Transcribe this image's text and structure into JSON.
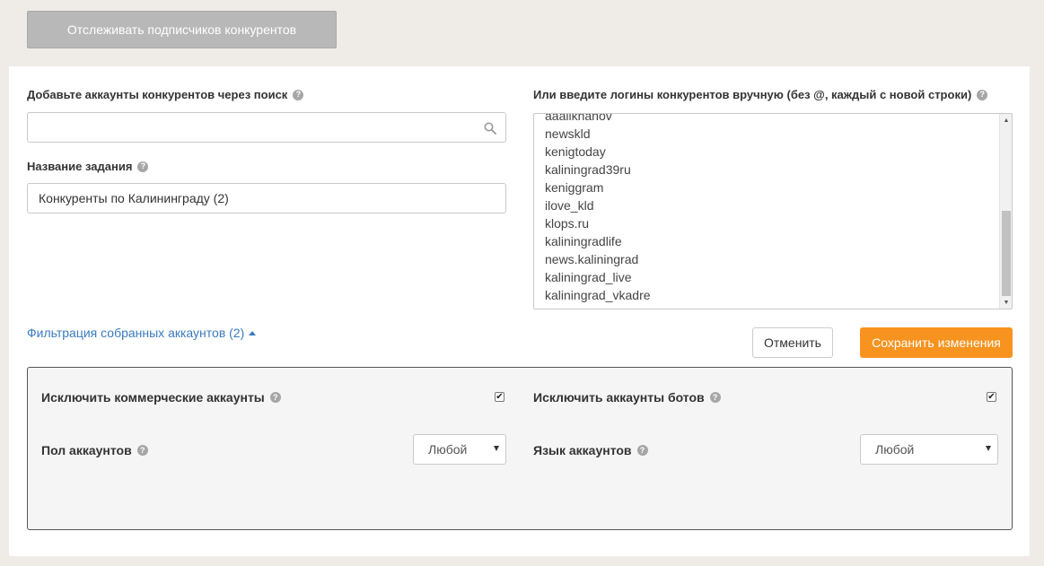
{
  "top_button": {
    "label": "Отслеживать подписчиков конкурентов"
  },
  "search_section": {
    "label": "Добавьте аккаунты конкурентов через поиск",
    "value": "",
    "placeholder": ""
  },
  "task_name": {
    "label": "Название задания",
    "value": "Конкуренты по Калининграду (2)"
  },
  "manual_logins": {
    "label": "Или введите логины конкурентов вручную (без @, каждый с новой строки)",
    "lines": [
      "aaalikhanov",
      "newskld",
      "kenigtoday",
      "kaliningrad39ru",
      "keniggram",
      "ilove_kld",
      "klops.ru",
      "kaliningradlife",
      "news.kaliningrad",
      "kaliningrad_live",
      "kaliningrad_vkadre"
    ]
  },
  "filter_link": {
    "label": "Фильтрация собранных аккаунтов (2)"
  },
  "buttons": {
    "cancel": "Отменить",
    "save": "Сохранить изменения"
  },
  "filters": {
    "exclude_commercial": {
      "label": "Исключить коммерческие аккаунты",
      "checked": true
    },
    "exclude_bots": {
      "label": "Исключить аккаунты ботов",
      "checked": true
    },
    "gender": {
      "label": "Пол аккаунтов",
      "selected": "Любой"
    },
    "language": {
      "label": "Язык аккаунтов",
      "selected": "Любой"
    }
  },
  "icons": {
    "help": "question-circle-icon",
    "search": "magnifier-icon",
    "check": "✔"
  },
  "colors": {
    "accent": "#f7931e",
    "link": "#3a7bbf",
    "top_button_bg": "#b8b8b8"
  }
}
